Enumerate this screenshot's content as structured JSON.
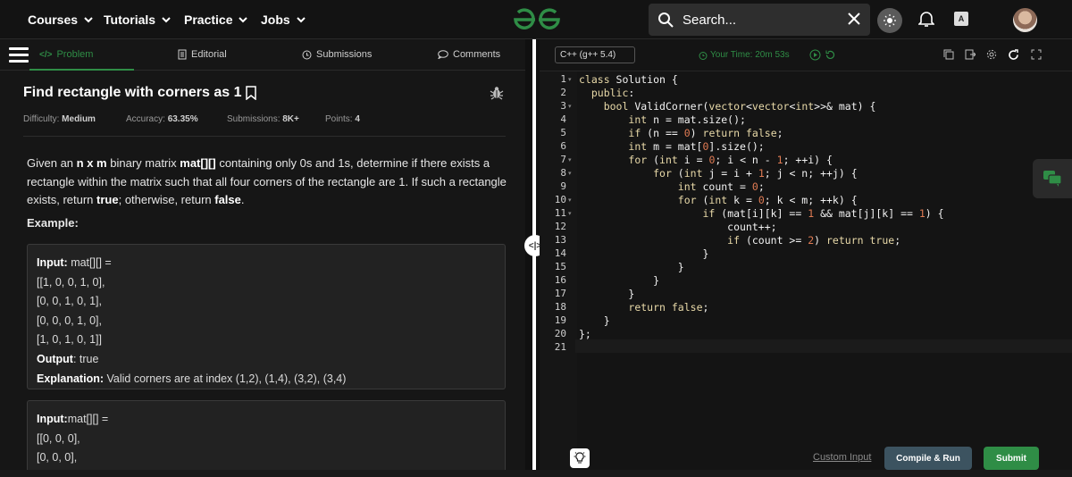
{
  "nav": {
    "items": [
      {
        "label": "Courses"
      },
      {
        "label": "Tutorials"
      },
      {
        "label": "Practice"
      },
      {
        "label": "Jobs"
      }
    ],
    "search_placeholder": "Search..."
  },
  "tabs": [
    {
      "label": "Problem"
    },
    {
      "label": "Editorial"
    },
    {
      "label": "Submissions"
    },
    {
      "label": "Comments"
    }
  ],
  "problem": {
    "title": "Find rectangle with corners as 1",
    "difficulty_label": "Difficulty:",
    "difficulty": "Medium",
    "accuracy_label": "Accuracy:",
    "accuracy": "63.35%",
    "submissions_label": "Submissions:",
    "submissions": "8K+",
    "points_label": "Points:",
    "points": "4",
    "desc": {
      "p1": "Given an ",
      "nxm": "n x m",
      "p2": " binary matrix ",
      "mat": "mat[][]",
      "p3": " containing only 0s and 1s, determine if there exists a rectangle within the matrix such that all four corners of the rectangle are 1. If such a rectangle exists, return ",
      "true": "true",
      "p4": "; otherwise, return ",
      "false": "false",
      "p5": "."
    },
    "example_heading": "Example:",
    "example1": {
      "input_label": "Input:",
      "input_var": " mat[][] =",
      "rows": [
        "[[1,  0,  0,  1,  0],",
        "[0,  0,  1,  0,  1],",
        "[0,  0,  0,  1,  0],",
        "[1,  0,  1,  0,  1]]"
      ],
      "output_label": "Output",
      "output": ": true",
      "explanation_label": "Explanation:",
      "explanation": " Valid corners are at index (1,2), (1,4), (3,2), (3,4)"
    },
    "example2": {
      "input_label": "Input:",
      "input_var": "mat[][] =",
      "rows": [
        "[[0,  0,  0],",
        "[0,  0,  0],"
      ]
    }
  },
  "editor": {
    "language": "C++ (g++ 5.4)",
    "timer": "Your Time: 20m 53s",
    "line_numbers": [
      "1",
      "2",
      "3",
      "4",
      "5",
      "6",
      "7",
      "8",
      "9",
      "10",
      "11",
      "12",
      "13",
      "14",
      "15",
      "16",
      "17",
      "18",
      "19",
      "20",
      "21"
    ],
    "fold_lines": [
      1,
      3,
      7,
      8,
      10,
      11
    ],
    "code": [
      "class Solution {",
      "  public:",
      "    bool ValidCorner(vector<vector<int>>& mat) {",
      "        int n = mat.size();",
      "        if (n == 0) return false;",
      "        int m = mat[0].size();",
      "        for (int i = 0; i < n - 1; ++i) {",
      "            for (int j = i + 1; j < n; ++j) {",
      "                int count = 0;",
      "                for (int k = 0; k < m; ++k) {",
      "                    if (mat[i][k] == 1 && mat[j][k] == 1) {",
      "                        count++;",
      "                        if (count >= 2) return true;",
      "                    }",
      "                }",
      "            }",
      "        }",
      "        return false;",
      "    }",
      "};",
      ""
    ],
    "custom_input": "Custom Input",
    "compile_run": "Compile & Run",
    "submit": "Submit"
  },
  "colors": {
    "brand": "#2f8d46",
    "run_button": "#3c5360"
  }
}
